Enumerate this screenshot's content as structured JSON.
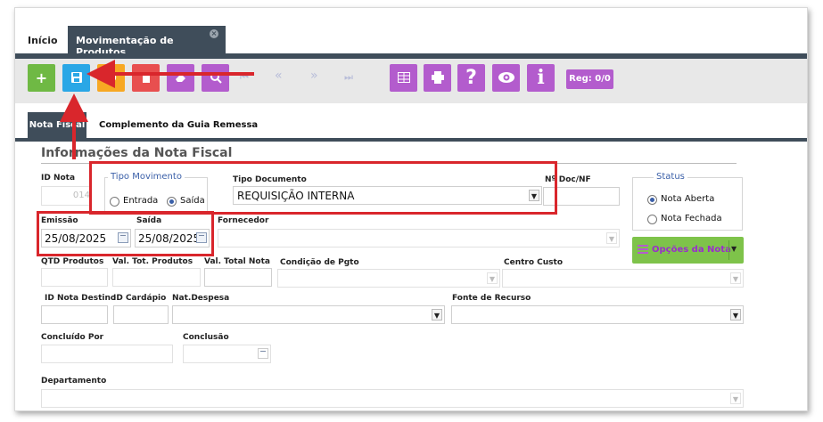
{
  "tabs": {
    "home": "Início",
    "active": "Movimentação de Produtos",
    "close_icon": "close-icon"
  },
  "toolbar": {
    "add_icon": "+",
    "save_icon": "save-icon",
    "undo_icon": "undo-icon",
    "delete_icon": "delete-icon",
    "clear_icon": "eraser-icon",
    "search_icon": "search-icon",
    "first_icon": "⏮",
    "prev_icon": "«",
    "next_icon": "»",
    "last_icon": "⏭",
    "grid_icon": "grid-icon",
    "print_icon": "print-icon",
    "help_icon": "?",
    "view_icon": "eye-icon",
    "info_icon": "i",
    "reg": "Reg: 0/0",
    "colors": {
      "green": "#6fb944",
      "blue": "#2aa7e6",
      "orange": "#f7a823",
      "red": "#e84f4f",
      "purple": "#b35ccd",
      "navy_light": "#b8bdd9"
    }
  },
  "subtabs": {
    "nota_fiscal": "Nota Fiscal",
    "complemento": "Complemento da Guia Remessa"
  },
  "section": {
    "title": "Informações da Nota Fiscal"
  },
  "form": {
    "id_nota": {
      "label": "ID Nota",
      "value": "014"
    },
    "tipo_movimento": {
      "legend": "Tipo Movimento",
      "entrada": "Entrada",
      "saida": "Saída",
      "selected": "Saída"
    },
    "tipo_documento": {
      "label": "Tipo Documento",
      "value": "REQUISIÇÃO INTERNA"
    },
    "num_doc": {
      "label": "Nº Doc/NF",
      "value": ""
    },
    "status": {
      "legend": "Status",
      "aberta": "Nota Aberta",
      "fechada": "Nota Fechada",
      "selected": "Nota Aberta"
    },
    "emissao": {
      "label": "Emissão",
      "value": "25/08/2025"
    },
    "saida": {
      "label": "Saída",
      "value": "25/08/2025"
    },
    "fornecedor": {
      "label": "Fornecedor",
      "value": ""
    },
    "opcoes": {
      "label": "Opções da Nota"
    },
    "qtd_produtos": {
      "label": "QTD Produtos",
      "value": ""
    },
    "val_tot_produtos": {
      "label": "Val. Tot. Produtos",
      "value": ""
    },
    "val_total_nota": {
      "label": "Val. Total Nota",
      "value": ""
    },
    "condicao_pgto": {
      "label": "Condição de Pgto",
      "value": ""
    },
    "centro_custo": {
      "label": "Centro Custo",
      "value": ""
    },
    "id_nota_destino": {
      "label": "ID Nota Destino",
      "value": ""
    },
    "id_cardapio": {
      "label": "ID Cardápio",
      "value": ""
    },
    "nat_despesa": {
      "label": "Nat.Despesa",
      "value": ""
    },
    "fonte_recurso": {
      "label": "Fonte de Recurso",
      "value": ""
    },
    "concluido_por": {
      "label": "Concluído Por",
      "value": ""
    },
    "conclusao": {
      "label": "Conclusão",
      "value": ""
    },
    "departamento": {
      "label": "Departamento",
      "value": ""
    }
  },
  "annotation_color": "#d9262c"
}
